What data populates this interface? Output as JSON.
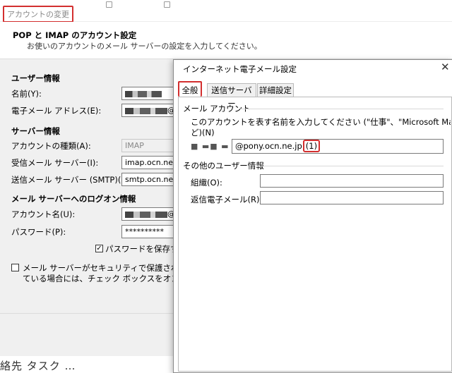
{
  "background_window": {
    "title": "アカウントの変更",
    "heading": "POP と IMAP のアカウント設定",
    "subheading": "お使いのアカウントのメール サーバーの設定を入力してください。",
    "user_section": "ユーザー情報",
    "name_label": "名前(Y):",
    "email_label": "電子メール アドレス(E):",
    "email_value_suffix": "@",
    "server_section": "サーバー情報",
    "account_type_label": "アカウントの種類(A):",
    "account_type_value": "IMAP",
    "incoming_label": "受信メール サーバー(I):",
    "incoming_value": "imap.ocn.ne.",
    "outgoing_label": "送信メール サーバー (SMTP)(O):",
    "outgoing_value": "smtp.ocn.ne.",
    "logon_section": "メール サーバーへのログオン情報",
    "account_name_label": "アカウント名(U):",
    "account_name_suffix": "@",
    "password_label": "パスワード(P):",
    "password_value": "**********",
    "save_password_label": "パスワードを保存する(R",
    "save_password_checked": true,
    "spa_label_line1": "メール サーバーがセキュリティで保護されたパスワード",
    "spa_label_line2": "ている場合には、チェック ボックスをオンにしてください(",
    "spa_checked": false,
    "bottom_text": "絡先 タスク …"
  },
  "dialog": {
    "title": "インターネット電子メール設定",
    "close_glyph": "✕",
    "tabs": [
      {
        "label": "全般",
        "active": true
      },
      {
        "label": "送信サーバー",
        "active": false
      },
      {
        "label": "詳細設定",
        "active": false
      }
    ],
    "mail_account_group": "メール アカウント",
    "mail_account_desc_line1": "このアカウントを表す名前を入力してください (\"仕事\"、\"Microsoft Mail サーバー\" な",
    "mail_account_desc_line2": "ど)(N)",
    "account_display_prefix": "■ ▬■ ▬",
    "account_display_value": "@pony.ocn.ne.jp",
    "account_display_suffix": "(1)",
    "other_user_group": "その他のユーザー情報",
    "organization_label": "組織(O):",
    "organization_value": "",
    "reply_email_label": "返信電子メール(R):",
    "reply_email_value": ""
  },
  "colors": {
    "highlight_red": "#d32f2f",
    "dialog_bg": "#f0f0f0"
  }
}
